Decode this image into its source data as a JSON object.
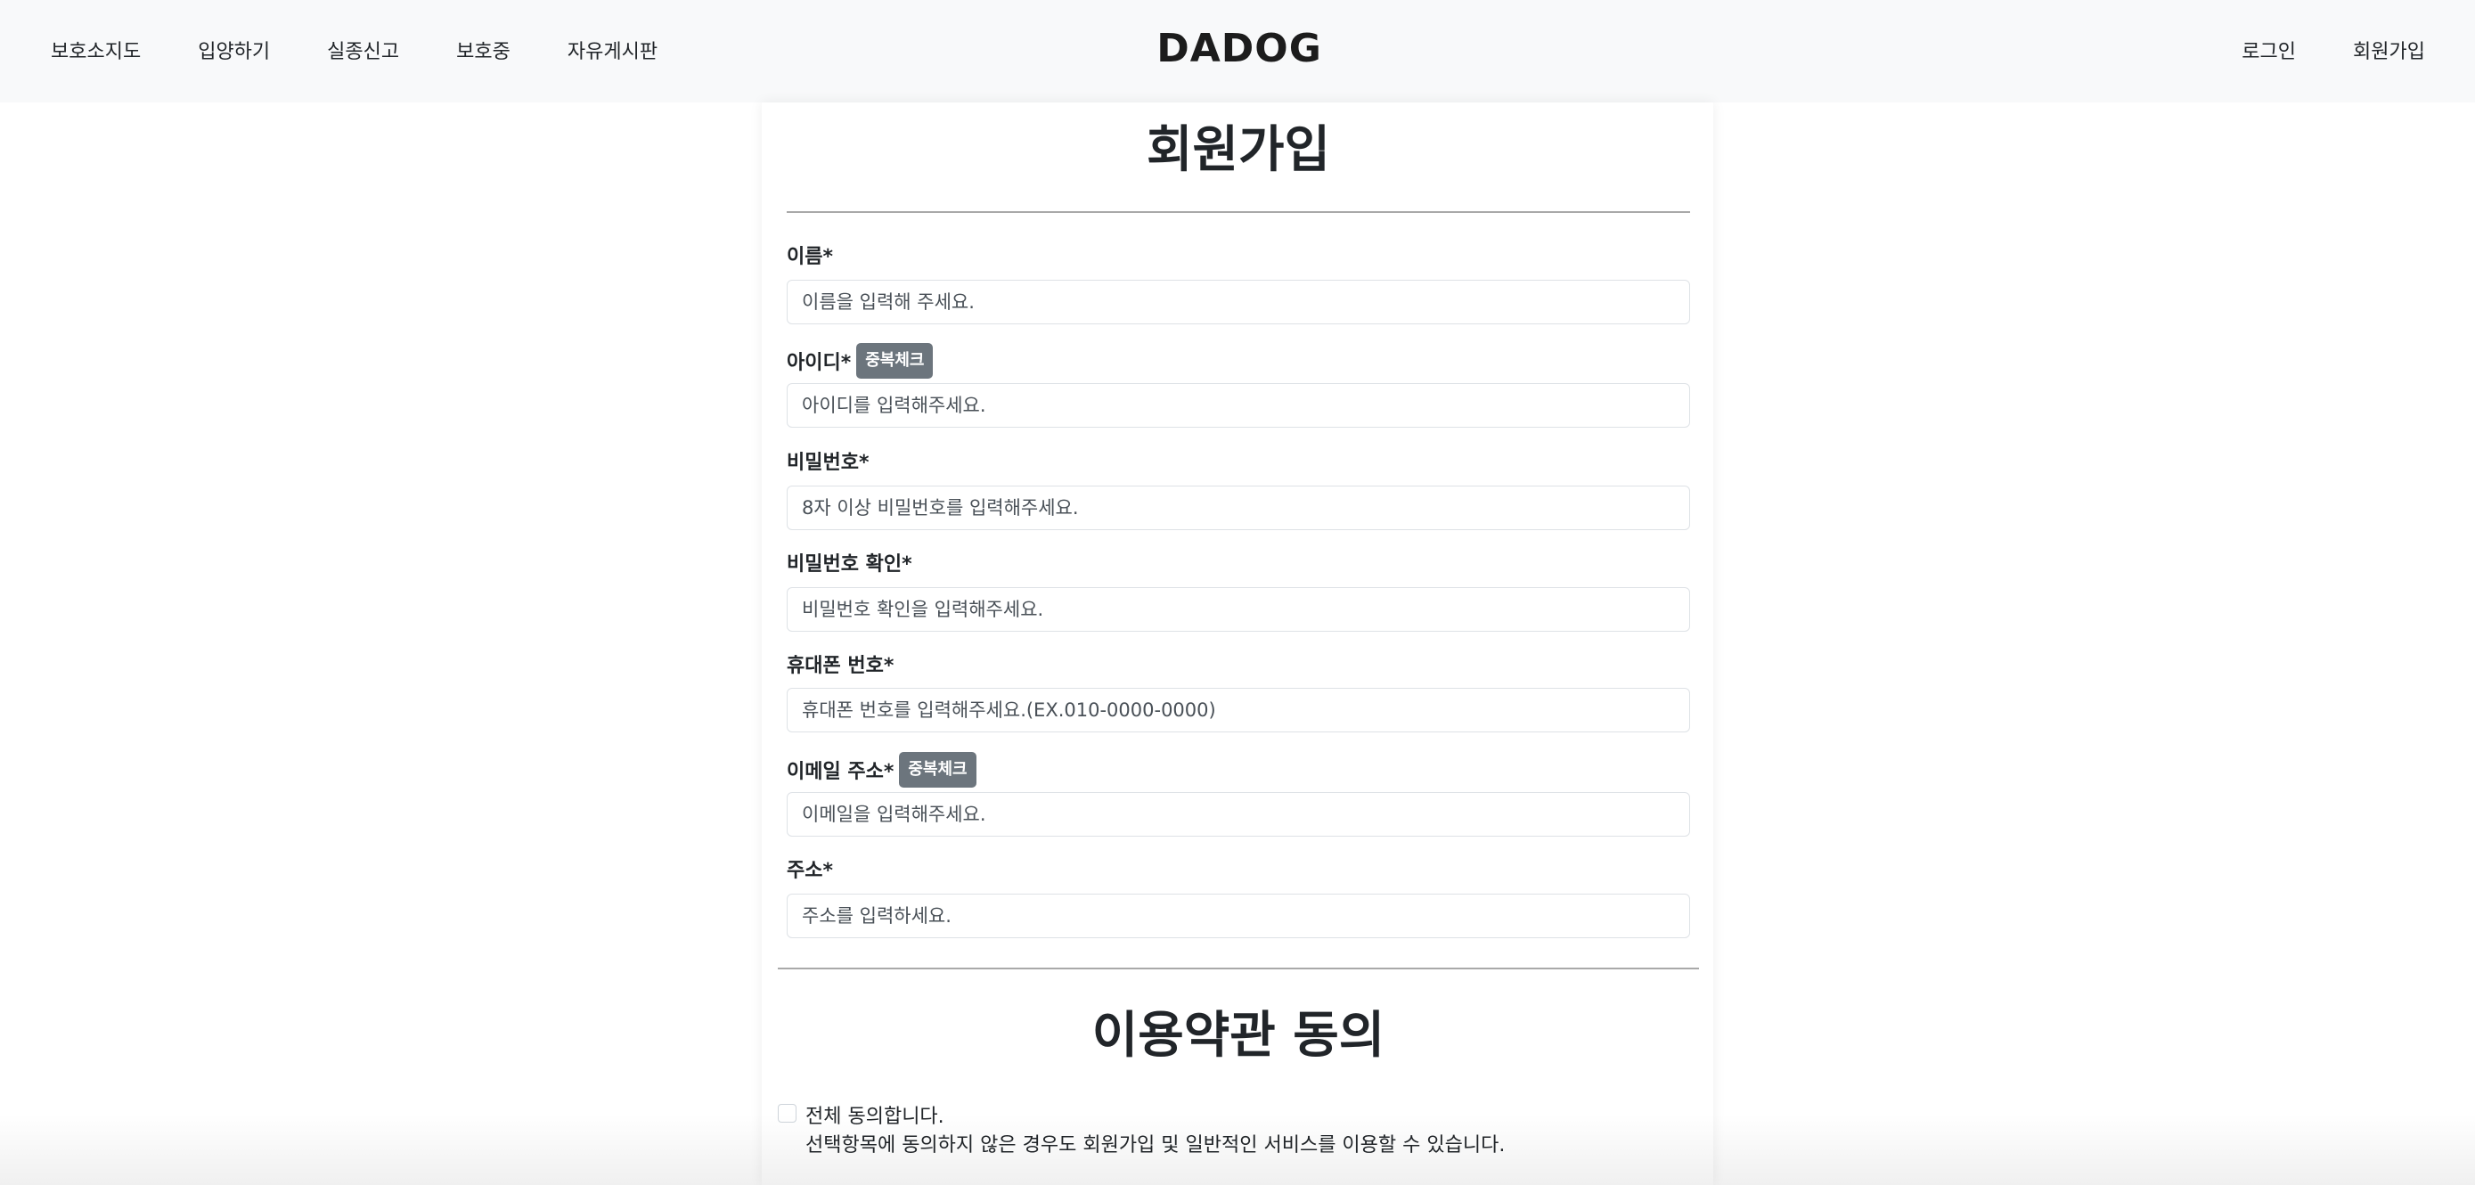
{
  "header": {
    "nav_left": [
      "보호소지도",
      "입양하기",
      "실종신고",
      "보호중",
      "자유게시판"
    ],
    "logo": "DADOG",
    "nav_right": [
      "로그인",
      "회원가입"
    ]
  },
  "form": {
    "title": "회원가입",
    "fields": {
      "name": {
        "label": "이름*",
        "placeholder": "이름을 입력해 주세요."
      },
      "user_id": {
        "label": "아이디*",
        "placeholder": "아이디를 입력해주세요.",
        "check_button": "중복체크"
      },
      "password": {
        "label": "비밀번호*",
        "placeholder": "8자 이상 비밀번호를 입력해주세요."
      },
      "password_confirm": {
        "label": "비밀번호 확인*",
        "placeholder": "비밀번호 확인을 입력해주세요."
      },
      "phone": {
        "label": "휴대폰 번호*",
        "placeholder": "휴대폰 번호를 입력해주세요.(EX.010-0000-0000)"
      },
      "email": {
        "label": "이메일 주소*",
        "placeholder": "이메일을 입력해주세요.",
        "check_button": "중복체크"
      },
      "address": {
        "label": "주소*",
        "placeholder": "주소를 입력하세요."
      }
    }
  },
  "terms": {
    "title": "이용약관 동의",
    "agree_all_label": "전체 동의합니다.",
    "agree_all_checked": false,
    "agree_all_desc": "선택항목에 동의하지 않은 경우도 회원가입 및 일반적인 서비스를 이용할 수 있습니다."
  },
  "colors": {
    "header_bg": "#f8f9fa",
    "button_bg": "#6c757d",
    "border": "#dee2e6",
    "rule": "#a9a9a9"
  }
}
